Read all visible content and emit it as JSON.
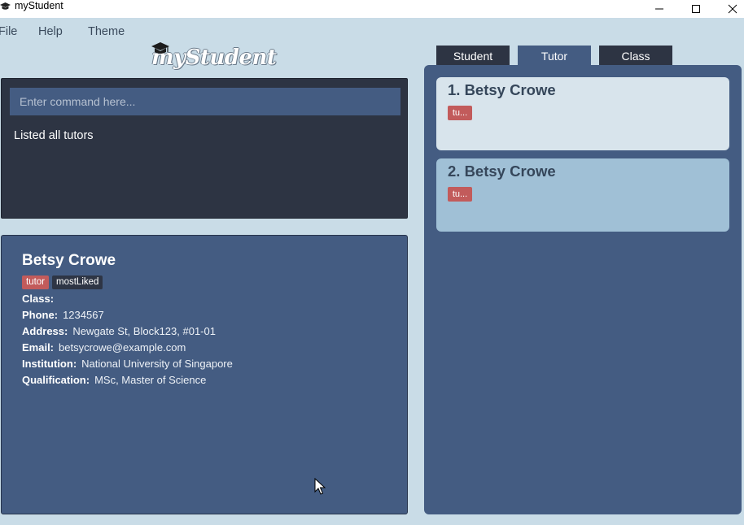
{
  "window": {
    "title": "myStudent",
    "minimize_icon": "minimize-icon",
    "maximize_icon": "maximize-icon",
    "close_icon": "close-icon"
  },
  "menu": {
    "items": [
      "File",
      "Help",
      "Theme"
    ]
  },
  "logo": {
    "text": "myStudent",
    "icon": "graduation-cap-icon"
  },
  "command": {
    "placeholder": "Enter command here...",
    "value": "",
    "result": "Listed all tutors"
  },
  "tabs": [
    {
      "label": "Student",
      "selected": false
    },
    {
      "label": "Tutor",
      "selected": true
    },
    {
      "label": "Class",
      "selected": false
    }
  ],
  "detail": {
    "name": "Betsy Crowe",
    "tags": [
      "tutor",
      "mostLiked"
    ],
    "fields": {
      "class": {
        "label": "Class:",
        "value": ""
      },
      "phone": {
        "label": "Phone:",
        "value": "1234567"
      },
      "address": {
        "label": "Address:",
        "value": "Newgate St, Block123, #01-01"
      },
      "email": {
        "label": "Email:",
        "value": "betsycrowe@example.com"
      },
      "institution": {
        "label": "Institution:",
        "value": "National University of Singapore"
      },
      "qualification": {
        "label": "Qualification:",
        "value": "MSc, Master of Science"
      }
    }
  },
  "list": {
    "items": [
      {
        "title": "1. Betsy Crowe",
        "tag": "tu..."
      },
      {
        "title": "2. Betsy Crowe",
        "tag": "tu..."
      }
    ]
  },
  "colors": {
    "background": "#c9dce7",
    "panel_dark": "#2d3443",
    "panel_blue": "#445c82",
    "tag_red": "#c25b5b",
    "card_light": "#d8e4ec",
    "card_selected": "#a0c0d6"
  }
}
